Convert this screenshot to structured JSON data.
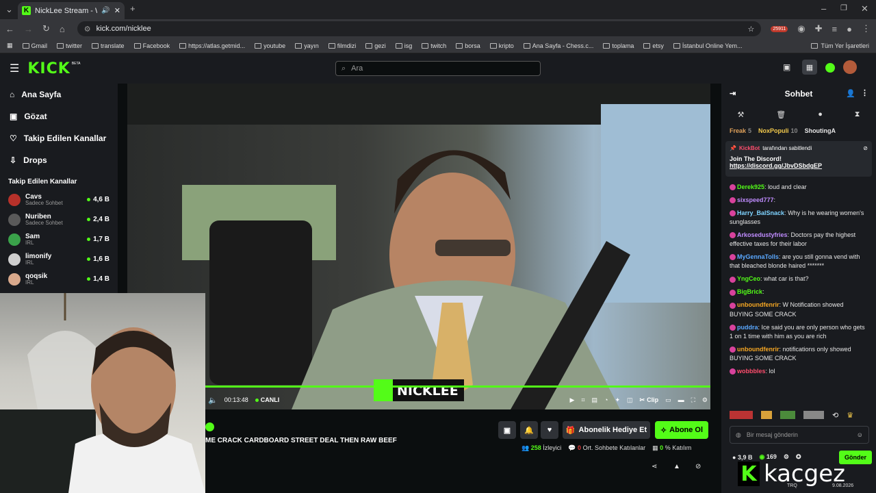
{
  "browser": {
    "tab_title": "NickLee Stream - Watch Li",
    "url": "kick.com/nicklee",
    "bookmarks": [
      "Gmail",
      "twitter",
      "translate",
      "Facebook",
      "https://atlas.getmid...",
      "youtube",
      "yayın",
      "filmdizi",
      "gezi",
      "isg",
      "twitch",
      "borsa",
      "kripto",
      "Ana Sayfa - Chess.c...",
      "toplama",
      "etsy",
      "İstanbul Online Yem..."
    ],
    "all_bookmarks": "Tüm Yer İşaretleri",
    "ext_badge": "25911"
  },
  "header": {
    "logo": "KICK",
    "beta": "BETA",
    "search_placeholder": "Ara"
  },
  "sidebar": {
    "nav": [
      {
        "label": "Ana Sayfa",
        "icon": "home-icon"
      },
      {
        "label": "Gözat",
        "icon": "browse-icon"
      },
      {
        "label": "Takip Edilen Kanallar",
        "icon": "heart-icon"
      },
      {
        "label": "Drops",
        "icon": "drops-icon"
      }
    ],
    "following_title": "Takip Edilen Kanallar",
    "channels": [
      {
        "name": "Cavs",
        "sub": "Sadece Sohbet",
        "viewers": "4,6 B",
        "color": "#b7312a"
      },
      {
        "name": "Nuriben",
        "sub": "Sadece Sohbet",
        "viewers": "2,4 B",
        "color": "#5a5a5a"
      },
      {
        "name": "Sam",
        "sub": "IRL",
        "viewers": "1,7 B",
        "color": "#3aa24a"
      },
      {
        "name": "limonify",
        "sub": "IRL",
        "viewers": "1,6 B",
        "color": "#cfcfcf"
      },
      {
        "name": "qoqsik",
        "sub": "IRL",
        "viewers": "1,4 B",
        "color": "#d9a98c"
      }
    ]
  },
  "player": {
    "time": "00:13:48",
    "live": "CANLI",
    "clip": "Clip",
    "overlay_name": "NICKLEE"
  },
  "stream": {
    "title": "ME CRACK CARDBOARD STREET DEAL THEN RAW BEEF",
    "gift_sub": "Abonelik Hediye Et",
    "subscribe": "Abone Ol",
    "viewers_num": "258",
    "viewers_label": "İzleyici",
    "chatters_num": "0",
    "chatters_label": "Ort. Sohbete Katılanlar",
    "participation_num": "0",
    "participation_label": "% Katılım"
  },
  "chat": {
    "title": "Sohbet",
    "leaders": [
      {
        "name": "Freak",
        "n": "5",
        "color": "#e0a15a"
      },
      {
        "name": "NoxPopuli",
        "n": "10",
        "color": "#f2c94c"
      },
      {
        "name": "ShoutingA",
        "n": "",
        "color": "#e8e8e8"
      }
    ],
    "pinned_by_user": "KickBot",
    "pinned_by_suffix": "tarafından sabitlendi",
    "pinned_text": "Join The Discord!",
    "pinned_link": "https://discord.gg/JbvDSbdgEP",
    "messages": [
      {
        "user": "Derek925",
        "text": "loud and clear",
        "color": "#53fc18"
      },
      {
        "user": "sixspeed777",
        "text": "",
        "color": "#c08cff"
      },
      {
        "user": "Harry_BalSnack",
        "text": "Why is he wearing women's sunglasses",
        "color": "#7fd3ff"
      },
      {
        "user": "Arkosedustyfries",
        "text": "Doctors pay the highest effective taxes for their labor",
        "color": "#c08cff"
      },
      {
        "user": "MyGennaTolls",
        "text": "are you still gonna vend with that bleached blonde haired *******",
        "color": "#5aa8ff"
      },
      {
        "user": "YngCeo",
        "text": "what car is that?",
        "color": "#53fc18"
      },
      {
        "user": "BigBrick",
        "text": "",
        "color": "#53fc18"
      },
      {
        "user": "unboundfenrir",
        "text": "W Notification showed BUYING SOME CRACK",
        "color": "#f5a623"
      },
      {
        "user": "puddra",
        "text": "Ice said you are only person who gets 1 on 1 time with him as you are rich",
        "color": "#5aa8ff"
      },
      {
        "user": "unboundfenrir",
        "text": "notifications only showed BUYING SOME CRACK",
        "color": "#f5a623"
      },
      {
        "user": "wobbbles",
        "text": "lol",
        "color": "#ff4d6d"
      }
    ],
    "input_placeholder": "Bir mesaj gönderin",
    "send": "Gönder",
    "stat_a": "3,9 B",
    "stat_b": "169"
  },
  "watermark": "kacgez",
  "taskbar": {
    "lang": "TRQ",
    "date": "9.08.2026"
  }
}
